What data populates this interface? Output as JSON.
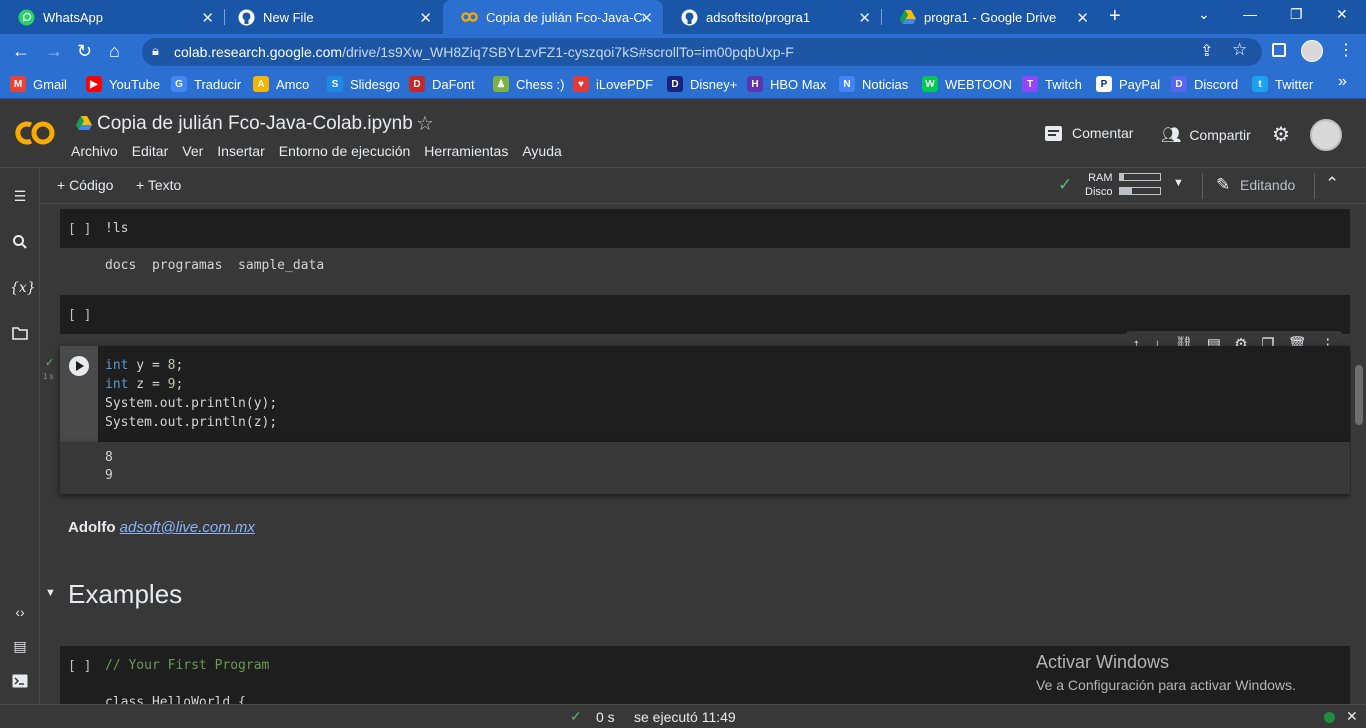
{
  "browser": {
    "tabs": [
      {
        "title": "WhatsApp",
        "icon": "whatsapp-icon"
      },
      {
        "title": "New File",
        "icon": "github-icon"
      },
      {
        "title": "Copia de julián Fco-Java-Cola",
        "icon": "colab-icon",
        "active": true
      },
      {
        "title": "adsoftsito/progra1",
        "icon": "github-icon"
      },
      {
        "title": "progra1 - Google Drive",
        "icon": "google-drive-icon"
      }
    ],
    "url_host": "colab.research.google.com",
    "url_path": "/drive/1s9Xw_WH8Ziq7SBYLzvFZ1-cyszqoi7kS#scrollTo=im00pqbUxp-F",
    "bookmarks": [
      {
        "label": "Gmail",
        "color": "#ea4335",
        "glyph": "M"
      },
      {
        "label": "YouTube",
        "color": "#ff0000",
        "glyph": "▶"
      },
      {
        "label": "Traducir",
        "color": "#4285f4",
        "glyph": "G"
      },
      {
        "label": "Amco",
        "color": "#f4b400",
        "glyph": "A"
      },
      {
        "label": "Slidesgo",
        "color": "#1e88e5",
        "glyph": "S"
      },
      {
        "label": "DaFont",
        "color": "#c62828",
        "glyph": "D"
      },
      {
        "label": "Chess :)",
        "color": "#7cb342",
        "glyph": "♟"
      },
      {
        "label": "iLovePDF",
        "color": "#e53935",
        "glyph": "♥"
      },
      {
        "label": "Disney+",
        "color": "#1a237e",
        "glyph": "D"
      },
      {
        "label": "HBO Max",
        "color": "#5e35b1",
        "glyph": "H"
      },
      {
        "label": "Noticias",
        "color": "#4285f4",
        "glyph": "N"
      },
      {
        "label": "WEBTOON",
        "color": "#00c853",
        "glyph": "W"
      },
      {
        "label": "Twitch",
        "color": "#9146ff",
        "glyph": "T"
      },
      {
        "label": "PayPal",
        "color": "#ffffff",
        "glyph": "P"
      },
      {
        "label": "Discord",
        "color": "#5865f2",
        "glyph": "D"
      },
      {
        "label": "Twitter",
        "color": "#1da1f2",
        "glyph": "t"
      }
    ],
    "bookmarks_more": "»"
  },
  "colab": {
    "title": "Copia de julián Fco-Java-Colab.ipynb",
    "menu": [
      "Archivo",
      "Editar",
      "Ver",
      "Insertar",
      "Entorno de ejecución",
      "Herramientas",
      "Ayuda"
    ],
    "comment_label": "Comentar",
    "share_label": "Compartir",
    "toolbar": {
      "code_label": "+ Código",
      "text_label": "+ Texto",
      "ram_label": "RAM",
      "disk_label": "Disco",
      "ram_fill": 0.1,
      "disk_fill": 0.3,
      "editing_label": "Editando"
    }
  },
  "cells": {
    "cell1": {
      "bracket": "[ ]",
      "code": "!ls",
      "output": "docs  programas  sample_data"
    },
    "cell2": {
      "bracket": "[ ]"
    },
    "cell3": {
      "exec_time": "1 s",
      "lines": {
        "l1_kw": "int",
        "l1_rest": " y = ",
        "l1_num": "8",
        "l1_end": ";",
        "l2_kw": "int",
        "l2_rest": " z = ",
        "l2_num": "9",
        "l2_end": ";",
        "l3": "System.out.println(y);",
        "l4": "System.out.println(z);"
      },
      "output": [
        "8",
        "9"
      ]
    },
    "text_cell": {
      "author": "Adolfo",
      "email": "adsoft@live.com.mx"
    },
    "section_heading": "Examples",
    "cell4": {
      "bracket": "[ ]",
      "comment": "// Your First Program",
      "partial_line": "class HelloWorld {"
    }
  },
  "statusbar": {
    "duration": "0 s",
    "executed": "se ejecutó 11:49"
  },
  "watermark": {
    "title": "Activar Windows",
    "subtitle": "Ve a Configuración para activar Windows."
  }
}
